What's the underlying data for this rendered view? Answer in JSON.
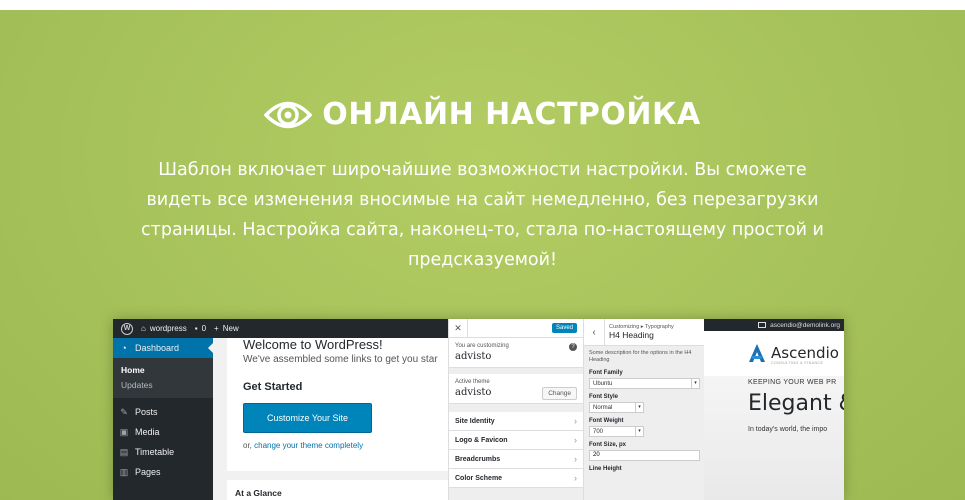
{
  "hero": {
    "title": "ОНЛАЙН НАСТРОЙКА",
    "icon": "eye-icon",
    "description": "Шаблон включает широчайшие возможности настройки. Вы сможете видеть все изменения вносимые на сайт немедленно, без перезагрузки страницы. Настройка сайта, наконец-то, стала по-настоящему простой и предсказуемой!"
  },
  "admin_bar": {
    "site_name": "wordpress",
    "comments_count": "0",
    "new_label": "New",
    "email": "ascendio@demolink.org"
  },
  "sidebar": {
    "dashboard": "Dashboard",
    "home": "Home",
    "updates": "Updates",
    "posts": "Posts",
    "media": "Media",
    "timetable": "Timetable",
    "pages": "Pages"
  },
  "welcome": {
    "title": "Welcome to WordPress!",
    "subtitle": "We've assembled some links to get you star",
    "get_started": "Get Started",
    "button": "Customize Your Site",
    "or_text": "or, ",
    "change_theme_link": "change your theme completely",
    "at_a_glance": "At a Glance"
  },
  "customizer": {
    "close": "✕",
    "saved": "Saved",
    "customizing_label": "You are customizing",
    "customizing_name": "advisto",
    "active_theme_label": "Active theme",
    "active_theme_name": "advisto",
    "change_button": "Change",
    "sections": [
      "Site Identity",
      "Logo & Favicon",
      "Breadcrumbs",
      "Color Scheme"
    ]
  },
  "typography": {
    "crumb": "Customizing ▸ Typography",
    "heading": "H4 Heading",
    "description": "Some description for the options in the H4 Heading",
    "font_family_label": "Font Family",
    "font_family_value": "Ubuntu",
    "font_style_label": "Font Style",
    "font_style_value": "Normal",
    "font_weight_label": "Font Weight",
    "font_weight_value": "700",
    "font_size_label": "Font Size, px",
    "font_size_value": "20",
    "line_height_label": "Line Height"
  },
  "preview": {
    "logo_text": "Ascendio",
    "logo_sub": "CONSULTING & FINANCE",
    "kicker": "KEEPING YOUR WEB PR",
    "headline": "Elegant &",
    "body": "In today's world, the impo"
  }
}
